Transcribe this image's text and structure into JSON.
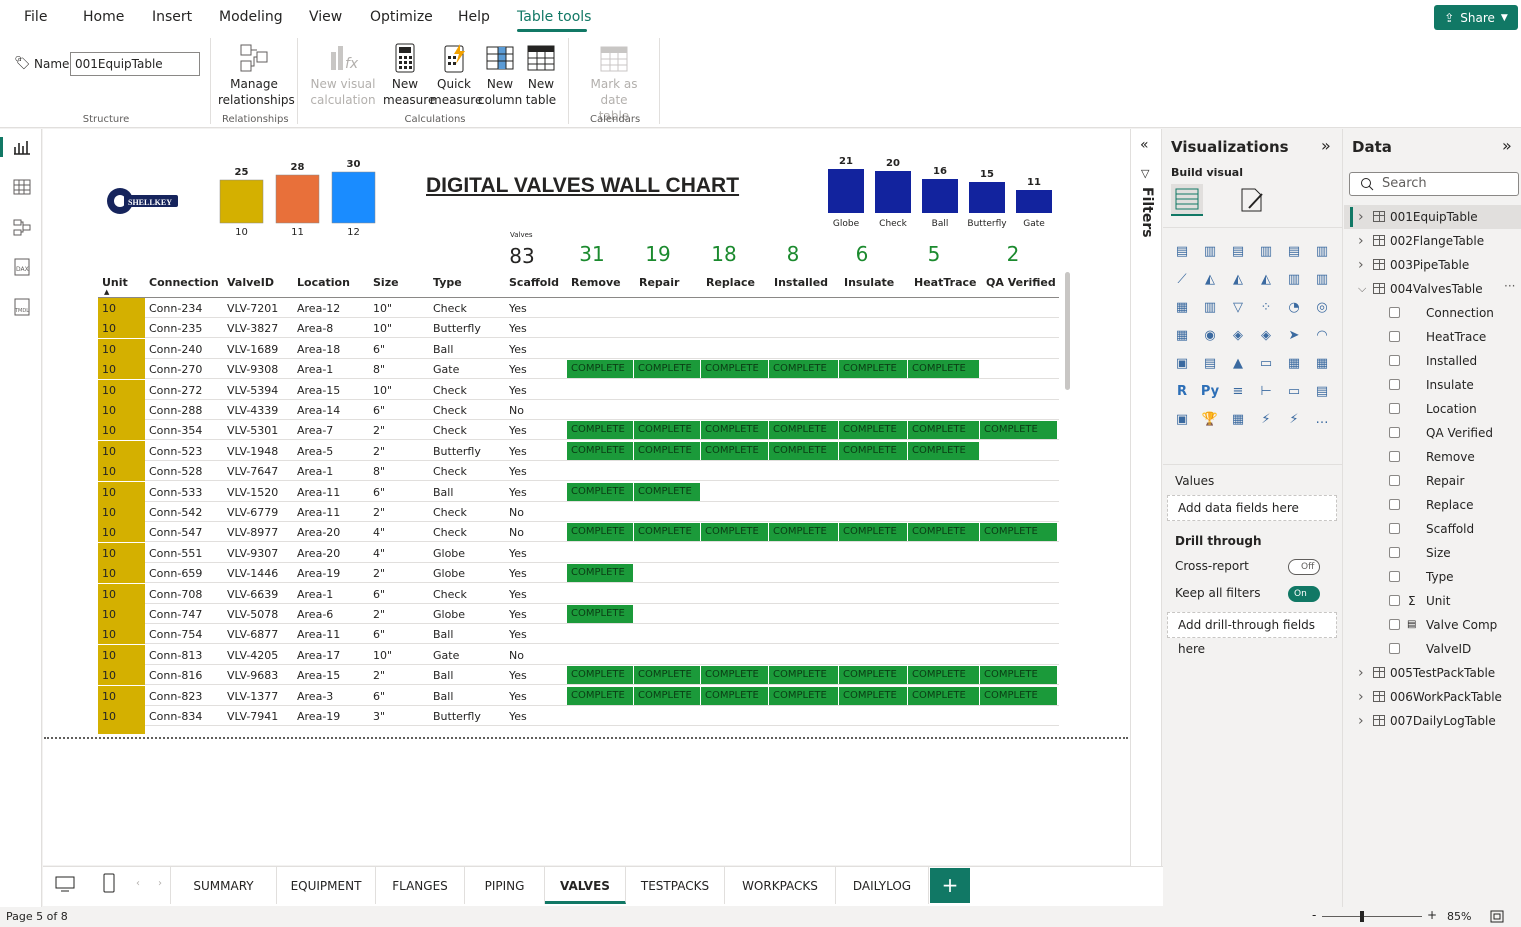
{
  "menu": {
    "items": [
      "File",
      "Home",
      "Insert",
      "Modeling",
      "View",
      "Optimize",
      "Help",
      "Table tools"
    ],
    "active": "Table tools",
    "share_label": "Share"
  },
  "ribbon": {
    "name_label": "Name",
    "name_value": "001EquipTable",
    "groups": {
      "structure": "Structure",
      "relationships": "Relationships",
      "calculations": "Calculations",
      "calendars": "Calendars"
    },
    "buttons": {
      "manage_rel_1": "Manage",
      "manage_rel_2": "relationships",
      "new_visual_calc_1": "New visual",
      "new_visual_calc_2": "calculation",
      "new_measure_1": "New",
      "new_measure_2": "measure",
      "quick_measure_1": "Quick",
      "quick_measure_2": "measure",
      "new_column_1": "New",
      "new_column_2": "column",
      "new_table_1": "New",
      "new_table_2": "table",
      "mark_date_1": "Mark as date",
      "mark_date_2": "table"
    }
  },
  "report": {
    "logo_text": "SHELLKEY",
    "title": "DIGITAL VALVES WALL CHART",
    "size_chart": {
      "categories": [
        "10",
        "11",
        "12"
      ],
      "values": [
        25,
        28,
        30
      ],
      "colors": [
        "#d4b000",
        "#e8703a",
        "#1a8cff"
      ]
    },
    "type_chart": {
      "categories": [
        "Globe",
        "Check",
        "Ball",
        "Butterfly",
        "Gate"
      ],
      "values": [
        21,
        20,
        16,
        15,
        11
      ],
      "color": "#12239e"
    },
    "valves_label": "Valves",
    "kpis": {
      "valves": "83",
      "remove": "31",
      "repair": "19",
      "replace": "18",
      "installed": "8",
      "insulate": "6",
      "heattrace": "5",
      "qa_verified": "2"
    },
    "columns": [
      "Unit",
      "Connection",
      "ValveID",
      "Location",
      "Size",
      "Type",
      "Scaffold",
      "Remove",
      "Repair",
      "Replace",
      "Installed",
      "Insulate",
      "HeatTrace",
      "QA Verified"
    ],
    "complete_label": "COMPLETE",
    "rows": [
      {
        "unit": "10",
        "conn": "Conn-234",
        "valve": "VLV-7201",
        "loc": "Area-12",
        "size": "10\"",
        "type": "Check",
        "scaf": "Yes",
        "done": 0
      },
      {
        "unit": "10",
        "conn": "Conn-235",
        "valve": "VLV-3827",
        "loc": "Area-8",
        "size": "10\"",
        "type": "Butterfly",
        "scaf": "Yes",
        "done": 0
      },
      {
        "unit": "10",
        "conn": "Conn-240",
        "valve": "VLV-1689",
        "loc": "Area-18",
        "size": "6\"",
        "type": "Ball",
        "scaf": "Yes",
        "done": 0
      },
      {
        "unit": "10",
        "conn": "Conn-270",
        "valve": "VLV-9308",
        "loc": "Area-1",
        "size": "8\"",
        "type": "Gate",
        "scaf": "Yes",
        "done": 6
      },
      {
        "unit": "10",
        "conn": "Conn-272",
        "valve": "VLV-5394",
        "loc": "Area-15",
        "size": "10\"",
        "type": "Check",
        "scaf": "Yes",
        "done": 0
      },
      {
        "unit": "10",
        "conn": "Conn-288",
        "valve": "VLV-4339",
        "loc": "Area-14",
        "size": "6\"",
        "type": "Check",
        "scaf": "No",
        "done": 0
      },
      {
        "unit": "10",
        "conn": "Conn-354",
        "valve": "VLV-5301",
        "loc": "Area-7",
        "size": "2\"",
        "type": "Check",
        "scaf": "Yes",
        "done": 7
      },
      {
        "unit": "10",
        "conn": "Conn-523",
        "valve": "VLV-1948",
        "loc": "Area-5",
        "size": "2\"",
        "type": "Butterfly",
        "scaf": "Yes",
        "done": 6
      },
      {
        "unit": "10",
        "conn": "Conn-528",
        "valve": "VLV-7647",
        "loc": "Area-1",
        "size": "8\"",
        "type": "Check",
        "scaf": "Yes",
        "done": 0
      },
      {
        "unit": "10",
        "conn": "Conn-533",
        "valve": "VLV-1520",
        "loc": "Area-11",
        "size": "6\"",
        "type": "Ball",
        "scaf": "Yes",
        "done": 2
      },
      {
        "unit": "10",
        "conn": "Conn-542",
        "valve": "VLV-6779",
        "loc": "Area-11",
        "size": "2\"",
        "type": "Check",
        "scaf": "No",
        "done": 0
      },
      {
        "unit": "10",
        "conn": "Conn-547",
        "valve": "VLV-8977",
        "loc": "Area-20",
        "size": "4\"",
        "type": "Check",
        "scaf": "No",
        "done": 7
      },
      {
        "unit": "10",
        "conn": "Conn-551",
        "valve": "VLV-9307",
        "loc": "Area-20",
        "size": "4\"",
        "type": "Globe",
        "scaf": "Yes",
        "done": 0
      },
      {
        "unit": "10",
        "conn": "Conn-659",
        "valve": "VLV-1446",
        "loc": "Area-19",
        "size": "2\"",
        "type": "Globe",
        "scaf": "Yes",
        "done": 1
      },
      {
        "unit": "10",
        "conn": "Conn-708",
        "valve": "VLV-6639",
        "loc": "Area-1",
        "size": "6\"",
        "type": "Check",
        "scaf": "Yes",
        "done": 0
      },
      {
        "unit": "10",
        "conn": "Conn-747",
        "valve": "VLV-5078",
        "loc": "Area-6",
        "size": "2\"",
        "type": "Globe",
        "scaf": "Yes",
        "done": 1
      },
      {
        "unit": "10",
        "conn": "Conn-754",
        "valve": "VLV-6877",
        "loc": "Area-11",
        "size": "6\"",
        "type": "Ball",
        "scaf": "Yes",
        "done": 0
      },
      {
        "unit": "10",
        "conn": "Conn-813",
        "valve": "VLV-4205",
        "loc": "Area-17",
        "size": "10\"",
        "type": "Gate",
        "scaf": "No",
        "done": 0
      },
      {
        "unit": "10",
        "conn": "Conn-816",
        "valve": "VLV-9683",
        "loc": "Area-15",
        "size": "2\"",
        "type": "Ball",
        "scaf": "Yes",
        "done": 7
      },
      {
        "unit": "10",
        "conn": "Conn-823",
        "valve": "VLV-1377",
        "loc": "Area-3",
        "size": "6\"",
        "type": "Ball",
        "scaf": "Yes",
        "done": 7
      },
      {
        "unit": "10",
        "conn": "Conn-834",
        "valve": "VLV-7941",
        "loc": "Area-19",
        "size": "3\"",
        "type": "Butterfly",
        "scaf": "Yes",
        "done": 0
      }
    ]
  },
  "tabs": [
    "SUMMARY",
    "EQUIPMENT",
    "FLANGES",
    "PIPING",
    "VALVES",
    "TESTPACKS",
    "WORKPACKS",
    "DAILYLOG"
  ],
  "active_tab": "VALVES",
  "status": {
    "page": "Page 5 of 8",
    "zoom": "85%"
  },
  "filters_label": "Filters",
  "viz": {
    "title": "Visualizations",
    "build_visual": "Build visual",
    "values_label": "Values",
    "add_data": "Add data fields here",
    "drill_through": "Drill through",
    "cross_report": "Cross-report",
    "cross_report_state": "Off",
    "keep_filters": "Keep all filters",
    "keep_filters_state": "On",
    "add_drill": "Add drill-through fields here"
  },
  "data": {
    "title": "Data",
    "search_placeholder": "Search",
    "tables_before": [
      "001EquipTable",
      "002FlangeTable",
      "003PipeTable"
    ],
    "expanded_table": "004ValvesTable",
    "fields": [
      "Connection",
      "HeatTrace",
      "Installed",
      "Insulate",
      "Location",
      "QA Verified",
      "Remove",
      "Repair",
      "Replace",
      "Scaffold",
      "Size",
      "Type",
      "Unit",
      "Valve Comp",
      "ValveID"
    ],
    "tables_after": [
      "005TestPackTable",
      "006WorkPackTable",
      "007DailyLogTable"
    ]
  }
}
